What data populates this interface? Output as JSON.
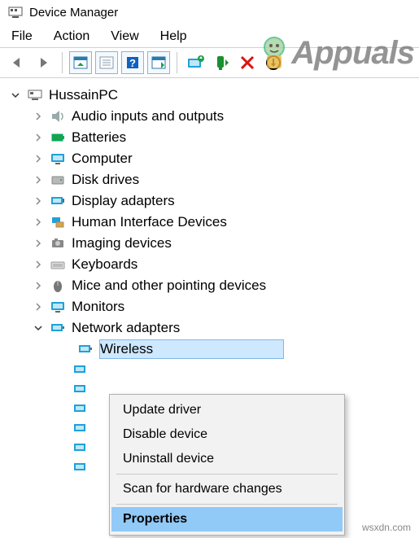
{
  "window": {
    "title": "Device Manager"
  },
  "menu": {
    "file": "File",
    "action": "Action",
    "view": "View",
    "help": "Help"
  },
  "tree": {
    "root": "HussainPC",
    "nodes": [
      {
        "label": "Audio inputs and outputs"
      },
      {
        "label": "Batteries"
      },
      {
        "label": "Computer"
      },
      {
        "label": "Disk drives"
      },
      {
        "label": "Display adapters"
      },
      {
        "label": "Human Interface Devices"
      },
      {
        "label": "Imaging devices"
      },
      {
        "label": "Keyboards"
      },
      {
        "label": "Mice and other pointing devices"
      },
      {
        "label": "Monitors"
      },
      {
        "label": "Network adapters"
      }
    ],
    "selected_child": "Wireless"
  },
  "context_menu": {
    "update": "Update driver",
    "disable": "Disable device",
    "uninstall": "Uninstall device",
    "scan": "Scan for hardware changes",
    "properties": "Properties"
  },
  "watermark": "Appuals",
  "footer": "wsxdn.com"
}
